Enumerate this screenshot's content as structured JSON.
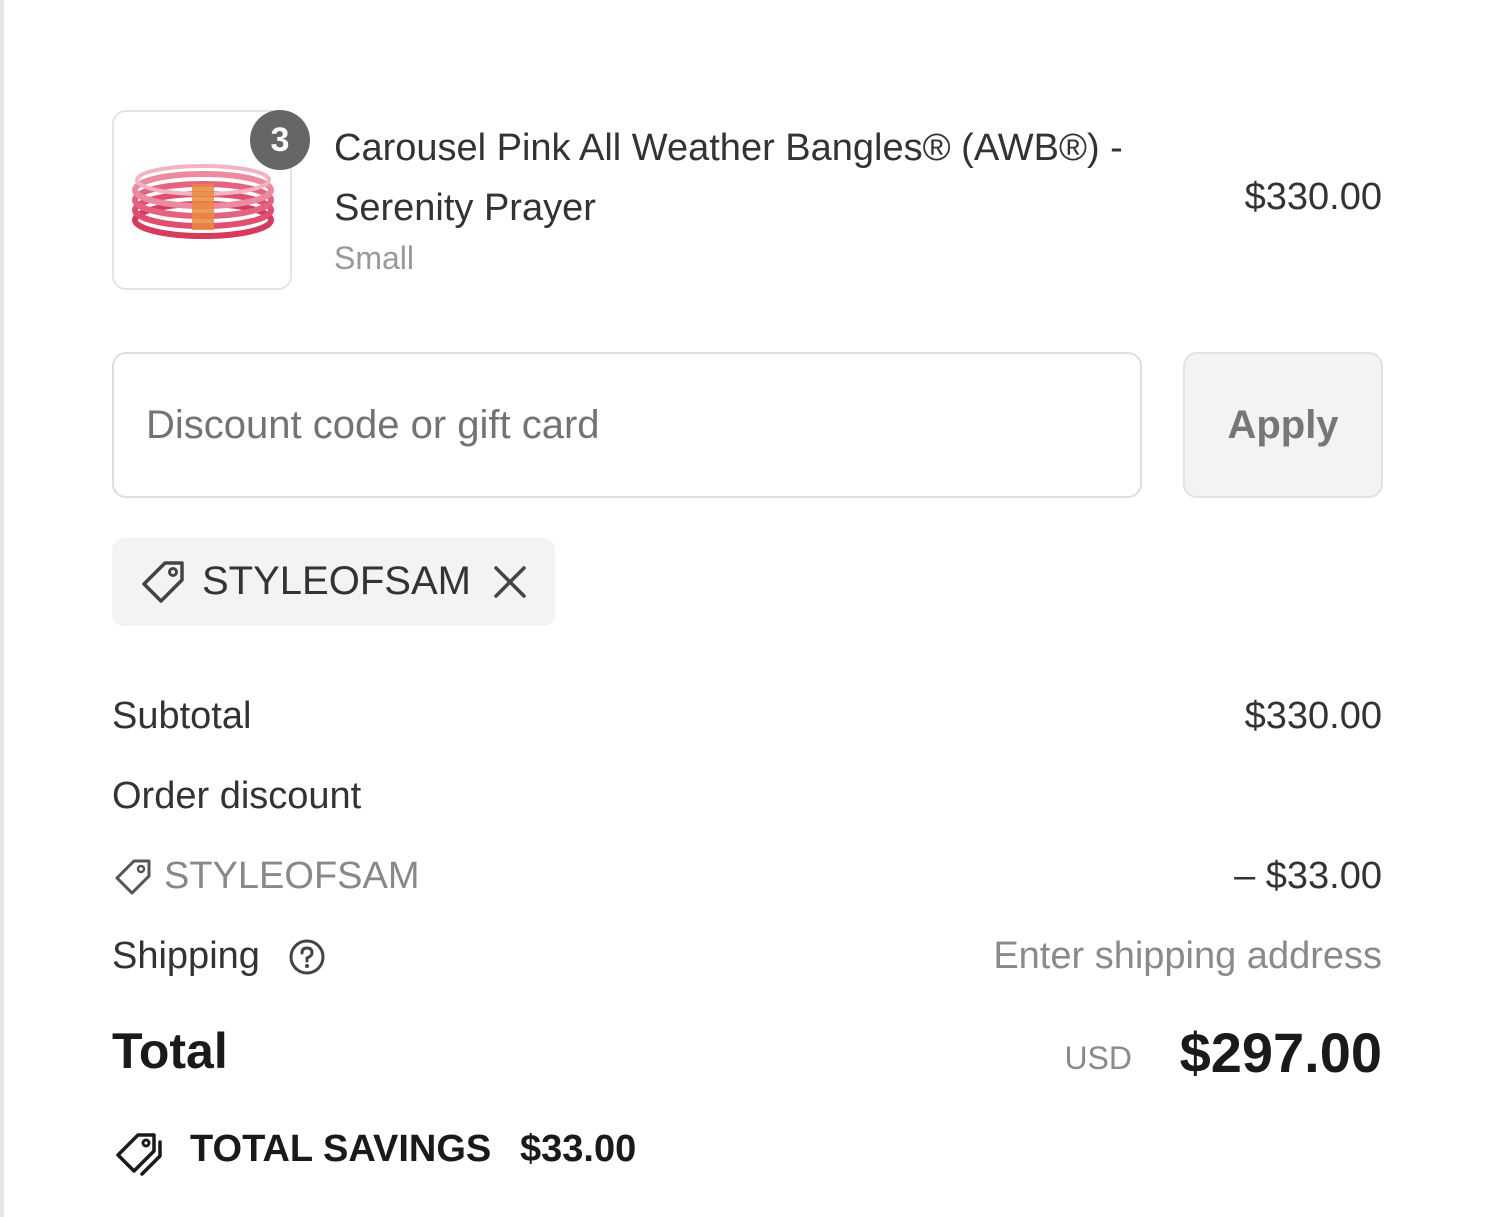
{
  "product": {
    "quantity": "3",
    "title": "Carousel Pink All Weather Bangles® (AWB®) - Serenity Prayer",
    "variant": "Small",
    "price": "$330.00",
    "image_icon": "bangles-image"
  },
  "discount": {
    "input_value": "",
    "placeholder": "Discount code or gift card",
    "apply_label": "Apply",
    "applied_code": "STYLEOFSAM"
  },
  "totals": {
    "subtotal_label": "Subtotal",
    "subtotal_value": "$330.00",
    "order_discount_label": "Order discount",
    "discount_code": "STYLEOFSAM",
    "discount_value": "– $33.00",
    "shipping_label": "Shipping",
    "shipping_value": "Enter shipping address",
    "total_label": "Total",
    "currency": "USD",
    "total_value": "$297.00",
    "savings_label": "TOTAL SAVINGS",
    "savings_value": "$33.00"
  },
  "colors": {
    "badge": "#666666",
    "chip_background": "#f3f3f3",
    "bangle_pink": "#e0506e",
    "bangle_gold": "#e98a3c"
  }
}
